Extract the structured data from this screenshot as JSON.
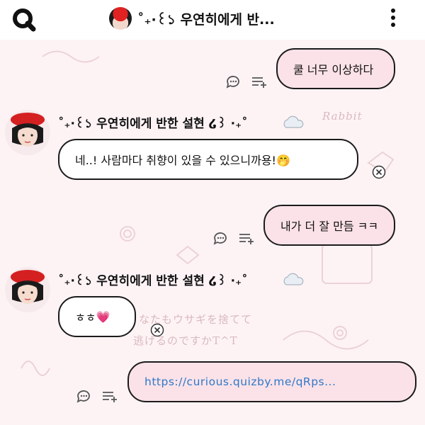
{
  "header": {
    "title": "˚₊·꒰১ 우연히에게 반..."
  },
  "messages": [
    {
      "from": "me",
      "text": "쿨 너무 이상하다"
    },
    {
      "from": "them",
      "sender": "˚₊·꒰১ 우연히에게 반한 설현 ໒꒱ ·₊˚",
      "text": "네..! 사람마다 취향이 있을 수 있으니까용!🤭"
    },
    {
      "from": "me",
      "text": "내가 더 잘 만듬 ㅋㅋ"
    },
    {
      "from": "them",
      "sender": "˚₊·꒰১ 우연히에게 반한 설현 ໒꒱ ·₊˚",
      "text": "ㅎㅎ",
      "emoji": "💗"
    },
    {
      "from": "me",
      "text": "https://curious.quizby.me/qRps..."
    }
  ],
  "background": {
    "decor_text_1": "なたもウサギを捨てて",
    "decor_text_2": "逃げるのですかT^T",
    "decor_text_3": "Rabbit"
  },
  "colors": {
    "my_bubble": "#fbe2e8",
    "their_bubble": "#ffffff",
    "link": "#2f78c8",
    "background": "#fdf3f5"
  },
  "icons": [
    "app-logo-icon",
    "more-vertical-icon",
    "comment-icon",
    "list-add-icon",
    "close-icon",
    "cloud-icon"
  ]
}
